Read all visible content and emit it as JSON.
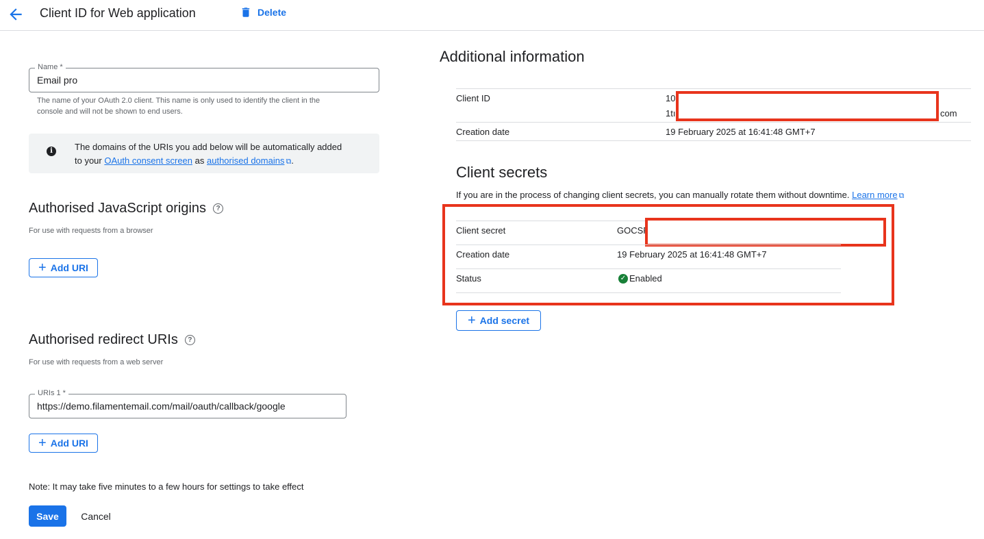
{
  "header": {
    "title": "Client ID for Web application",
    "delete_label": "Delete",
    "back_icon": "arrow-back-icon",
    "delete_icon": "trash-icon"
  },
  "form": {
    "name": {
      "label": "Name *",
      "value": "Email pro",
      "hint_line1": "The name of your OAuth 2.0 client. This name is only used to identify the client in the",
      "hint_line2": "console and will not be shown to end users."
    },
    "info": {
      "line1": "The domains of the URIs you add below will be automatically added",
      "prefix": "to your",
      "consent_link": "OAuth consent screen",
      "as": "as",
      "domains_link": "authorised domains",
      "suffix": "."
    },
    "js_origins": {
      "title": "Authorised JavaScript origins",
      "subtitle": "For use with requests from a browser",
      "add_label": "Add URI"
    },
    "redirect_uris": {
      "title": "Authorised redirect URIs",
      "subtitle": "For use with requests from a web server",
      "uri_label": "URIs 1 *",
      "uri_value": "https://demo.filamentemail.com/mail/oauth/callback/google",
      "add_label": "Add URI"
    },
    "note": "Note: It may take five minutes to a few hours for settings to take effect",
    "save_label": "Save",
    "cancel_label": "Cancel"
  },
  "additional": {
    "title": "Additional information",
    "client_id_label": "Client ID",
    "client_id_line1_prefix": "10",
    "client_id_line2_prefix": "1tı",
    "client_id_line2_suffix": "com",
    "creation_label": "Creation date",
    "creation_value": "19 February 2025 at 16:41:48 GMT+7"
  },
  "secrets": {
    "title": "Client secrets",
    "desc": "If you are in the process of changing client secrets, you can manually rotate them without downtime.",
    "learn_more": "Learn more",
    "secret_label": "Client secret",
    "secret_prefix": "GOCSF",
    "creation_label": "Creation date",
    "creation_value": "19 February 2025 at 16:41:48 GMT+7",
    "status_label": "Status",
    "status_value": "Enabled",
    "add_label": "Add secret"
  },
  "colors": {
    "accent": "#1a73e8",
    "redaction": "#e8341c",
    "enabled": "#188038"
  }
}
